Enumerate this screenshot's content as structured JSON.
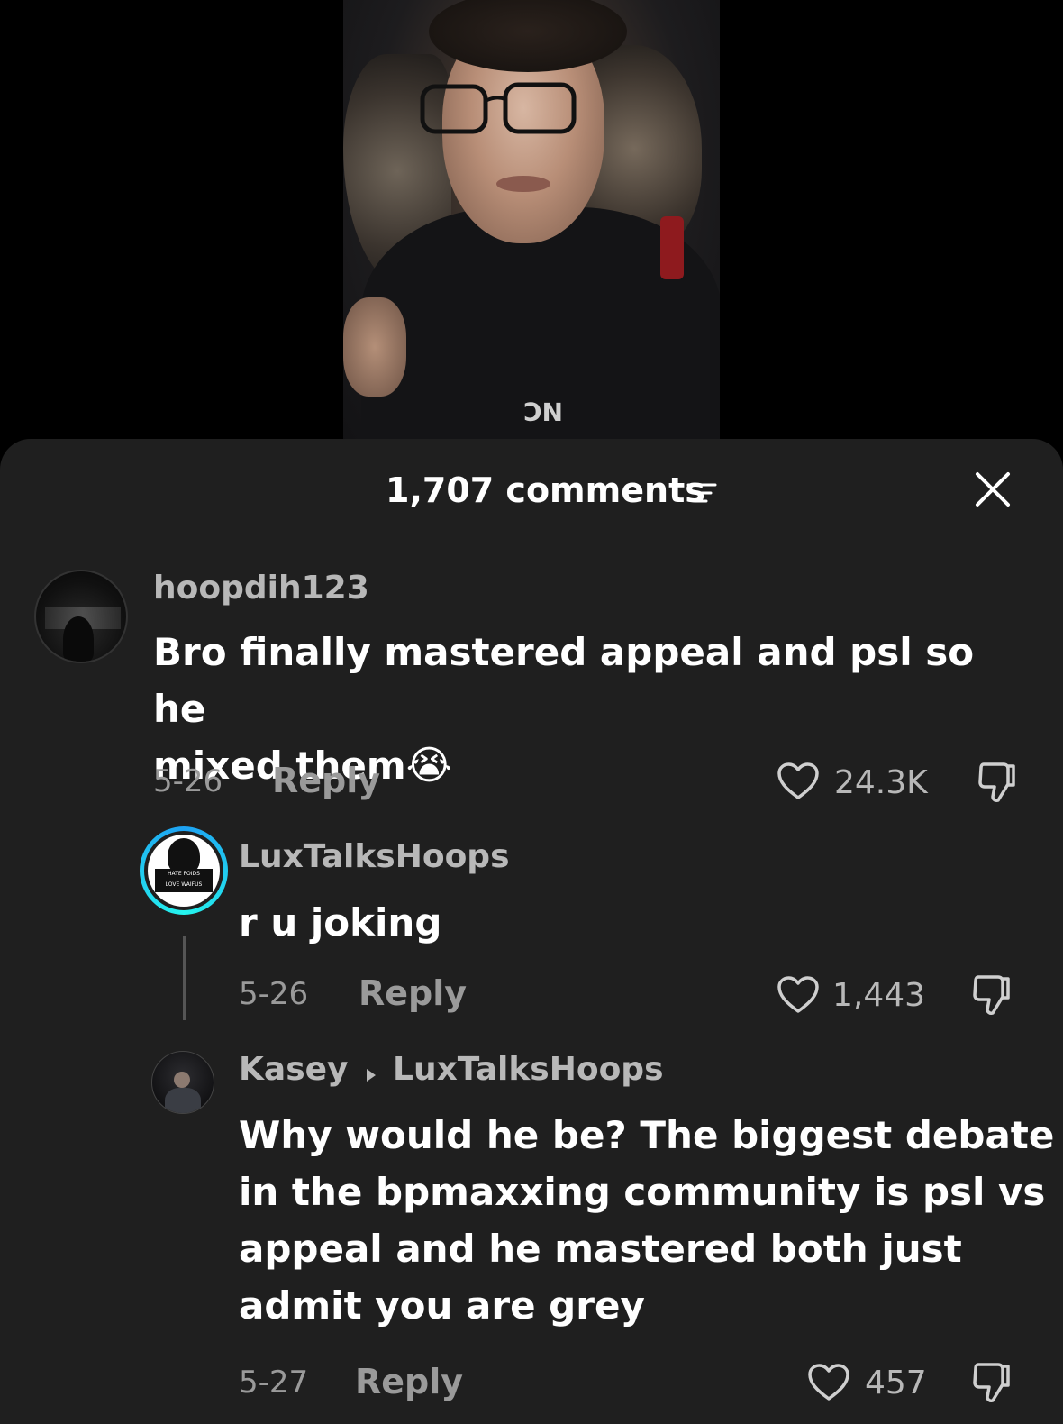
{
  "header": {
    "comment_count_label": "1,707 comments",
    "sort_icon": "filter-lines-icon",
    "close_icon": "close-x-icon"
  },
  "video": {
    "shirt_text": "NC"
  },
  "comments": [
    {
      "username": "hoopdih123",
      "text_line1": "Bro finally mastered appeal and psl so he",
      "text_line2": "mixed them",
      "emoji": "😭",
      "date": "5-26",
      "reply_label": "Reply",
      "likes": "24.3K"
    },
    {
      "username": "LuxTalksHoops",
      "avatar_text_top": "HATE FOIDS",
      "avatar_text_bottom": "LOVE WAIFUS",
      "text": "r u joking",
      "date": "5-26",
      "reply_label": "Reply",
      "likes": "1,443"
    },
    {
      "username": "Kasey",
      "reply_to": "LuxTalksHoops",
      "text_lines": [
        "Why would he be? The biggest debate",
        "in the bpmaxxing community is psl vs",
        "appeal and he mastered both just",
        "admit you are grey"
      ],
      "date": "5-27",
      "reply_label": "Reply",
      "likes": "457"
    }
  ],
  "colors": {
    "sheet_bg": "#1f1f1f",
    "muted_text": "#9a9a9a",
    "username_text": "#b8b8b8",
    "story_ring_start": "#1da1f2",
    "story_ring_end": "#25f4ee"
  }
}
